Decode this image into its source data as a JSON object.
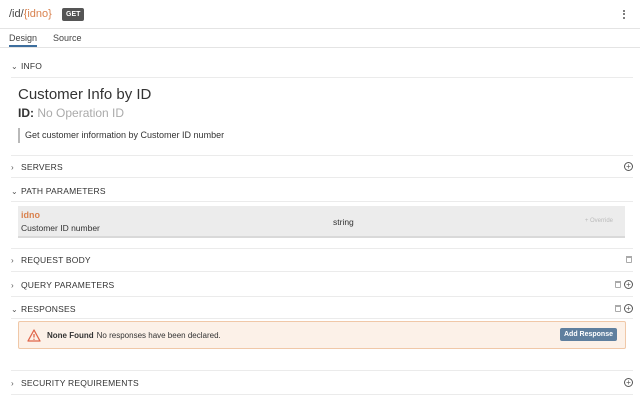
{
  "header": {
    "path_prefix": "/id/",
    "path_param": "{idno}",
    "method": "GET",
    "menu_icon": "kebab-menu-icon"
  },
  "tabs": [
    {
      "label": "Design",
      "active": true
    },
    {
      "label": "Source",
      "active": false
    }
  ],
  "sections": {
    "info": "INFO",
    "servers": "SERVERS",
    "path_parameters": "PATH PARAMETERS",
    "request_body": "REQUEST BODY",
    "query_parameters": "QUERY PARAMETERS",
    "responses": "RESPONSES",
    "security": "SECURITY REQUIREMENTS"
  },
  "info": {
    "title": "Customer Info by ID",
    "op_id_label": "ID:",
    "op_id_placeholder": "No Operation ID",
    "description": "Get customer information by Customer ID number"
  },
  "path_param": {
    "name": "idno",
    "description": "Customer ID number",
    "type": "string",
    "override_label": "+ Override"
  },
  "responses_alert": {
    "title": "None Found",
    "message": "No responses have been declared.",
    "button": "Add Response"
  },
  "colors": {
    "accent": "#3d6e9e",
    "param": "#d9824f",
    "warning_bg": "#fcf1e8",
    "button": "#5f7f9e"
  }
}
